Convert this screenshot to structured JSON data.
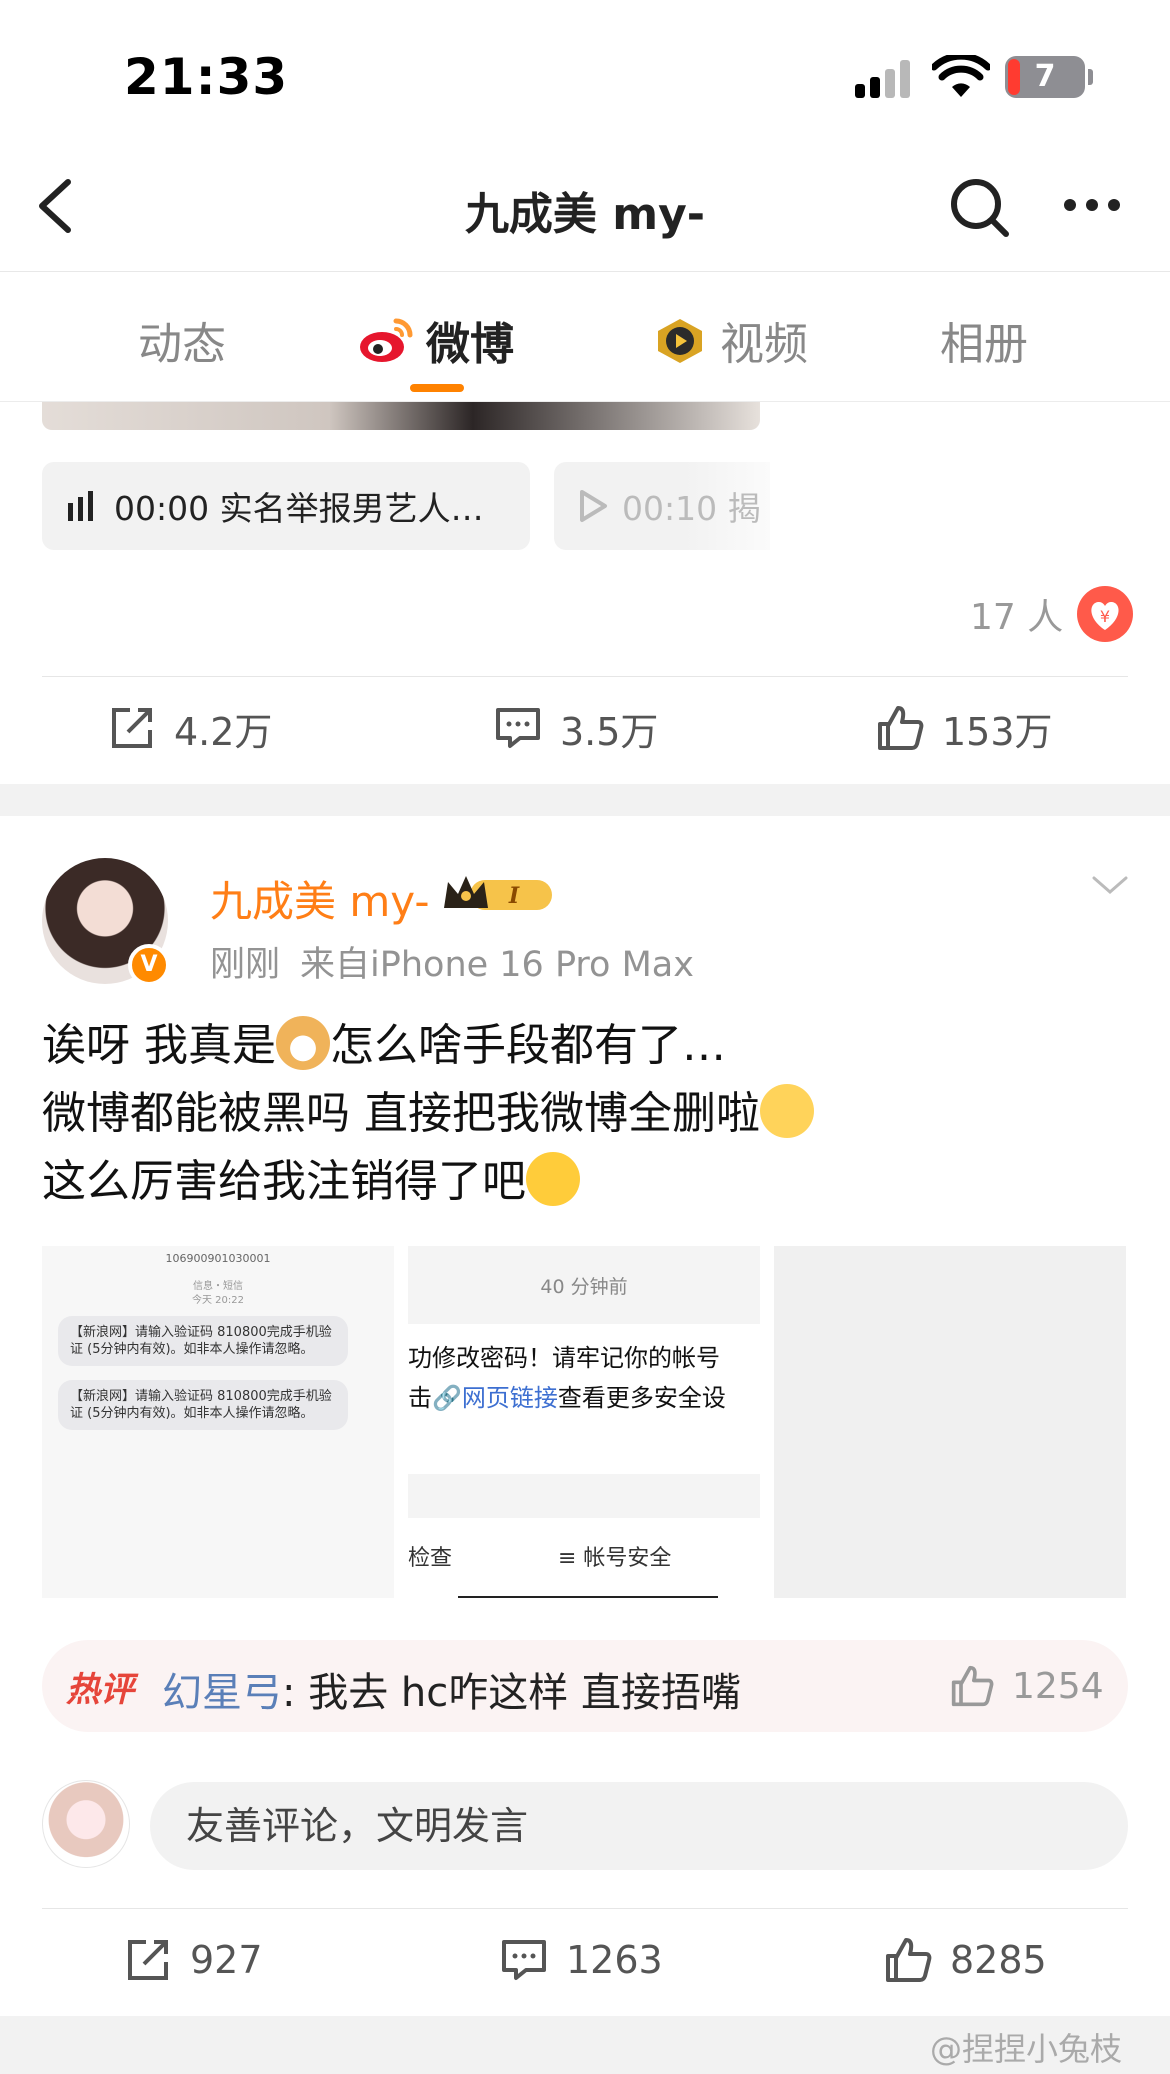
{
  "status_bar": {
    "time": "21:33",
    "battery": "7"
  },
  "nav": {
    "title": "九成美 my-"
  },
  "tabs": [
    {
      "label": "动态"
    },
    {
      "label": "微博"
    },
    {
      "label": "视频"
    },
    {
      "label": "相册"
    }
  ],
  "post1": {
    "audio_label": "00:00 实名举报男艺人…",
    "video_label": "00:10 揭",
    "reward_count": "17 人",
    "reposts": "4.2万",
    "comments": "3.5万",
    "likes": "153万"
  },
  "post2": {
    "author": "九成美 my-",
    "time": "刚刚",
    "source": "来自iPhone 16 Pro Max",
    "text_line1": "诶呀 我真是",
    "text_line1b": "怎么啥手段都有了…",
    "text_line2": "微博都能被黑吗 直接把我微博全删啦",
    "text_line3": "这么厉害给我注销得了吧",
    "images": {
      "sms_number": "106900901030001",
      "sms_sub1": "信息・短信",
      "sms_sub2": "今天 20:22",
      "sms_msg": "【新浪网】请输入验证码 810800完成手机验证 (5分钟内有效)。如非本人操作请忽略。",
      "notice_time": "40 分钟前",
      "notice_line1": "功修改密码！请牢记你的帐号",
      "notice_line2a": "击",
      "notice_link": "🔗网页链接",
      "notice_line2b": "查看更多安全设",
      "tool1": "检查",
      "tool2": "≡ 帐号安全"
    },
    "hot_comment": {
      "badge": "热评",
      "user": "幻星弓",
      "text": ": 我去 hc咋这样 直接捂嘴",
      "likes": "1254"
    },
    "comment_placeholder": "友善评论，文明发言",
    "reposts": "927",
    "comments": "1263",
    "likes": "8285"
  },
  "watermark": "@捏捏小兔枝"
}
